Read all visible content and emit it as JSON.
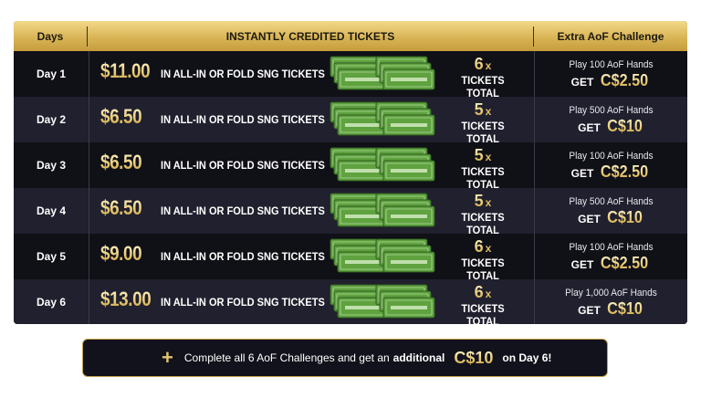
{
  "header": {
    "days": "Days",
    "tickets": "INSTANTLY CREDITED TICKETS",
    "extra": "Extra AoF Challenge"
  },
  "ticket_desc": "IN ALL-IN OR FOLD SNG TICKETS",
  "tickets_total": "TICKETS TOTAL",
  "x_label": "x",
  "get_label": "GET",
  "rows": [
    {
      "day": "Day 1",
      "amount": "$11.00",
      "count": "6",
      "hands": "Play 100 AoF Hands",
      "reward": "C$2.50"
    },
    {
      "day": "Day 2",
      "amount": "$6.50",
      "count": "5",
      "hands": "Play 500 AoF Hands",
      "reward": "C$10"
    },
    {
      "day": "Day 3",
      "amount": "$6.50",
      "count": "5",
      "hands": "Play 100 AoF Hands",
      "reward": "C$2.50"
    },
    {
      "day": "Day 4",
      "amount": "$6.50",
      "count": "5",
      "hands": "Play 500 AoF Hands",
      "reward": "C$10"
    },
    {
      "day": "Day 5",
      "amount": "$9.00",
      "count": "6",
      "hands": "Play 100 AoF Hands",
      "reward": "C$2.50"
    },
    {
      "day": "Day 6",
      "amount": "$13.00",
      "count": "6",
      "hands": "Play 1,000 AoF Hands",
      "reward": "C$10"
    }
  ],
  "bonus": {
    "plus": "+",
    "text1": "Complete all 6 AoF Challenges and get an",
    "text2": "additional",
    "amount": "C$10",
    "text3": "on Day 6!"
  },
  "colors": {
    "gold": "#d9b556",
    "ticket_green": "#5fa23f",
    "row_dark": "#101017",
    "row_light": "#20202e"
  }
}
